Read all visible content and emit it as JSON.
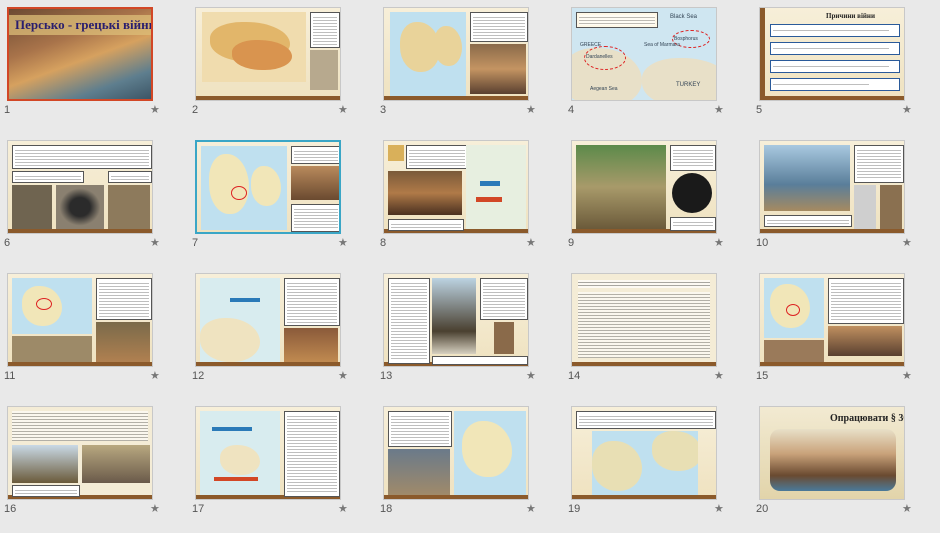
{
  "slides": [
    {
      "number": "1",
      "title": "Персько - грецькі війни"
    },
    {
      "number": "2"
    },
    {
      "number": "3"
    },
    {
      "number": "4",
      "labels": [
        "Black Sea",
        "Bosphorus",
        "Sea of Marmara",
        "Dardanelles",
        "Aegean Sea",
        "GREECE",
        "TURKEY"
      ]
    },
    {
      "number": "5",
      "title": "Причини війни"
    },
    {
      "number": "6"
    },
    {
      "number": "7"
    },
    {
      "number": "8"
    },
    {
      "number": "9"
    },
    {
      "number": "10"
    },
    {
      "number": "11"
    },
    {
      "number": "12"
    },
    {
      "number": "13"
    },
    {
      "number": "14"
    },
    {
      "number": "15"
    },
    {
      "number": "16"
    },
    {
      "number": "17"
    },
    {
      "number": "18"
    },
    {
      "number": "19"
    },
    {
      "number": "20",
      "title": "Опрацювати § 36."
    }
  ],
  "star_icon": "★",
  "colors": {
    "selection": "#d24726",
    "selection_secondary": "#3aa6c6",
    "background": "#e9e9e9"
  }
}
